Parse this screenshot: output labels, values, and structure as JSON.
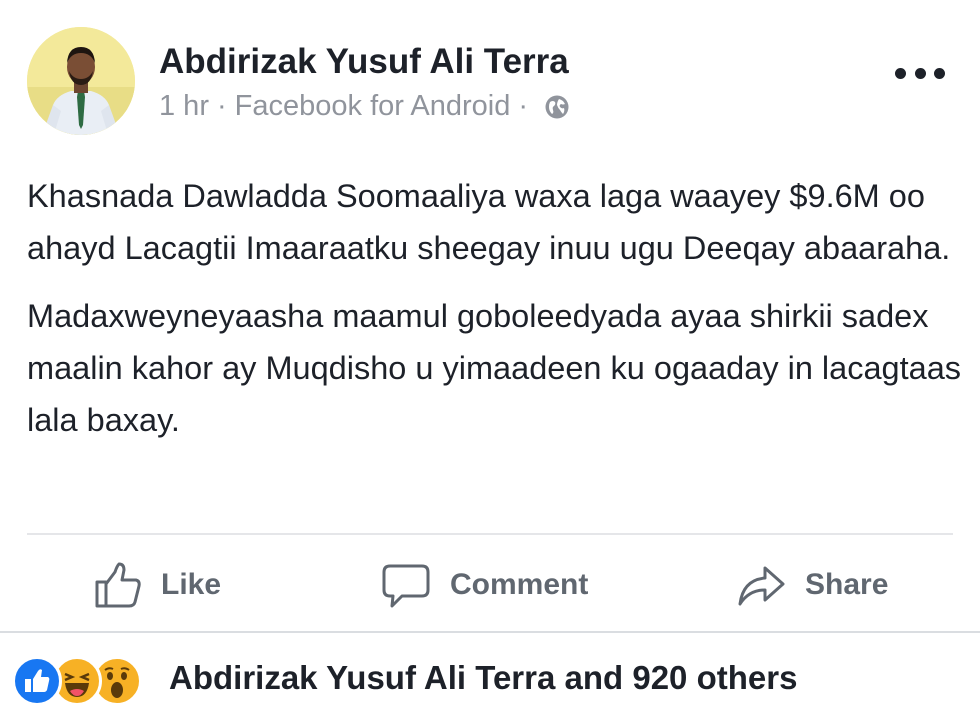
{
  "post": {
    "author": "Abdirizak Yusuf Ali Terra",
    "time": "1 hr",
    "source": "Facebook for Android",
    "separator": "·",
    "paragraphs": [
      "Khasnada Dawladda Soomaaliya waxa laga waayey $9.6M oo ahayd Lacagtii Imaaraatku sheegay inuu ugu Deeqay abaaraha.",
      "Madaxweyneyaasha maamul goboleedyada ayaa shirkii sadex maalin kahor ay Muqdisho u yimaadeen ku ogaaday in lacagtaas lala baxay."
    ]
  },
  "actions": {
    "like_label": "Like",
    "comment_label": "Comment",
    "share_label": "Share"
  },
  "reactions": {
    "icons": [
      "like-icon",
      "haha-icon",
      "wow-icon"
    ],
    "summary": "Abdirizak Yusuf Ali Terra and 920 others"
  },
  "colors": {
    "like_blue": "#1877f2",
    "reaction_yellow": "#f7b125",
    "meta_gray": "#90949c",
    "action_gray": "#606770"
  }
}
